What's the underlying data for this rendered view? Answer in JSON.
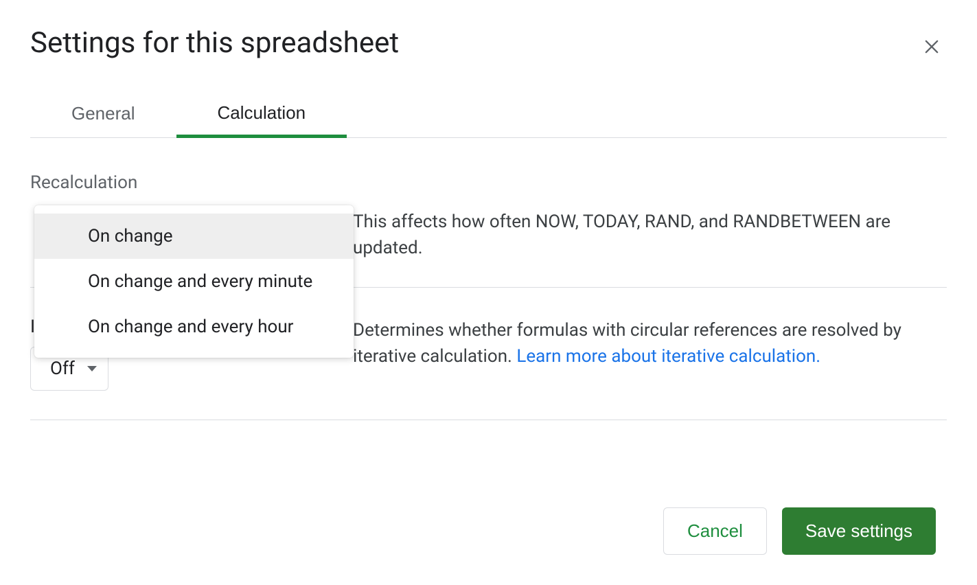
{
  "dialog": {
    "title": "Settings for this spreadsheet"
  },
  "tabs": {
    "general": "General",
    "calculation": "Calculation"
  },
  "recalc": {
    "label": "Recalculation",
    "options": [
      "On change",
      "On change and every minute",
      "On change and every hour"
    ],
    "description": "This affects how often NOW, TODAY, RAND, and RANDBETWEEN are updated."
  },
  "iterative": {
    "hidden_label_visible_char": "I",
    "select_value": "Off",
    "description_prefix": "Determines whether formulas with circular references are resolved by iterative calculation. ",
    "link_text": "Learn more about iterative calculation."
  },
  "footer": {
    "cancel": "Cancel",
    "save": "Save settings"
  }
}
